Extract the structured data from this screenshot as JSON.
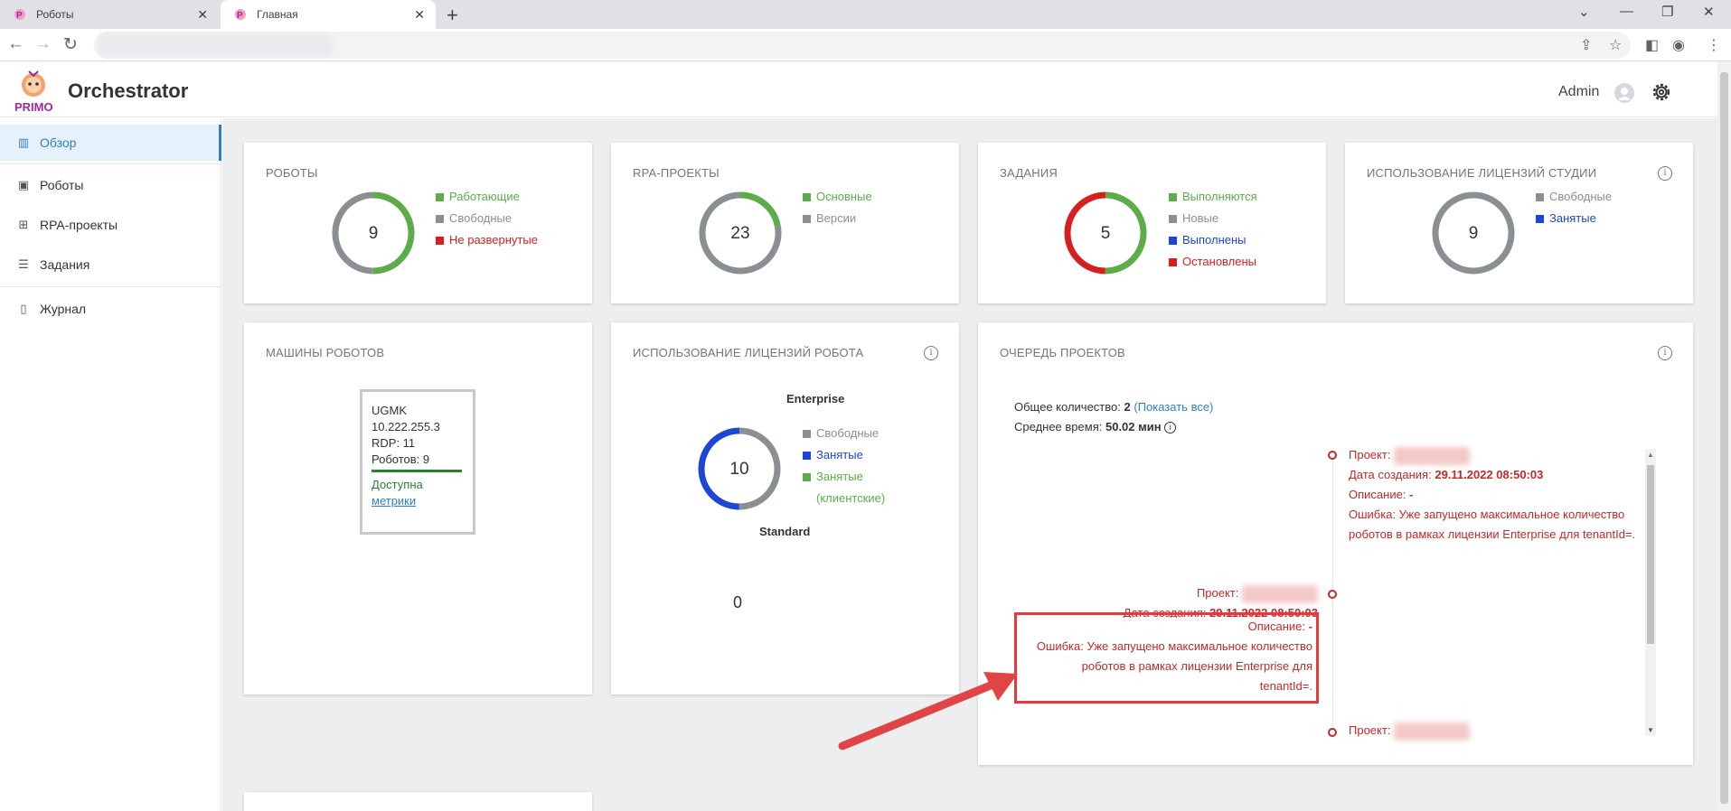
{
  "browser": {
    "tabs": [
      {
        "label": "Роботы",
        "active": false
      },
      {
        "label": "Главная",
        "active": true
      }
    ],
    "new_tab": "+",
    "controls": {
      "minimize": "—",
      "maximize": "❐",
      "close": "✕",
      "dropdown": "⌄"
    },
    "nav": {
      "back": "←",
      "forward": "→",
      "reload": "↻"
    }
  },
  "app": {
    "title": "Orchestrator",
    "logo_text": "PRIMO",
    "user": "Admin",
    "colors": {
      "accent": "#2f7fc1",
      "green": "#5cad4a",
      "grey": "#8a8f94",
      "red": "#d62020",
      "blue": "#1c47d6",
      "logo": "#9c2aa3"
    }
  },
  "sidebar": {
    "items": [
      {
        "label": "Обзор",
        "icon": "bar-chart-icon",
        "glyph": "▥",
        "active": true
      },
      {
        "label": "Роботы",
        "icon": "robot-icon",
        "glyph": "▣"
      },
      {
        "label": "RPA-проекты",
        "icon": "hierarchy-icon",
        "glyph": "⊞"
      },
      {
        "label": "Задания",
        "icon": "list-icon",
        "glyph": "☰"
      },
      {
        "label": "Журнал",
        "icon": "journal-icon",
        "glyph": "▯"
      }
    ]
  },
  "cards": {
    "robots": {
      "title": "РОБОТЫ",
      "total": "9",
      "legend": [
        {
          "label": "Работающие",
          "color": "green"
        },
        {
          "label": "Свободные",
          "color": "grey"
        },
        {
          "label": "Не развернутые",
          "color": "red"
        }
      ],
      "donut": [
        {
          "color": "#5cad4a",
          "fraction": 0.5
        },
        {
          "color": "#8a8f94",
          "fraction": 0.5
        }
      ]
    },
    "projects": {
      "title": "RPA-ПРОЕКТЫ",
      "total": "23",
      "legend": [
        {
          "label": "Основные",
          "color": "green"
        },
        {
          "label": "Версии",
          "color": "grey"
        }
      ],
      "donut": [
        {
          "color": "#5cad4a",
          "fraction": 0.22
        },
        {
          "color": "#8a8f94",
          "fraction": 0.78
        }
      ]
    },
    "jobs": {
      "title": "ЗАДАНИЯ",
      "total": "5",
      "legend": [
        {
          "label": "Выполняются",
          "color": "green"
        },
        {
          "label": "Новые",
          "color": "grey"
        },
        {
          "label": "Выполнены",
          "color": "blue"
        },
        {
          "label": "Остановлены",
          "color": "red"
        }
      ],
      "donut": [
        {
          "color": "#5cad4a",
          "fraction": 0.5
        },
        {
          "color": "#d62020",
          "fraction": 0.5
        }
      ]
    },
    "studio_licenses": {
      "title": "ИСПОЛЬЗОВАНИЕ ЛИЦЕНЗИЙ СТУДИИ",
      "total": "9",
      "legend": [
        {
          "label": "Свободные",
          "color": "grey"
        },
        {
          "label": "Занятые",
          "color": "blue"
        }
      ],
      "donut": [
        {
          "color": "#8a8f94",
          "fraction": 1.0
        }
      ]
    },
    "machines": {
      "title": "МАШИНЫ РОБОТОВ",
      "machine": {
        "name": "UGMK",
        "ip": "10.222.255.3",
        "rdp": "RDP: 11",
        "robots": "Роботов: 9",
        "status": "Доступна",
        "metrics": "метрики"
      }
    },
    "robot_licenses": {
      "title": "ИСПОЛЬЗОВАНИЕ ЛИЦЕНЗИЙ РОБОТА",
      "enterprise_label": "Enterprise",
      "enterprise_total": "10",
      "legend": [
        {
          "label": "Свободные",
          "color": "grey"
        },
        {
          "label": "Занятые",
          "color": "blue"
        },
        {
          "label": "Занятые (клиентские)",
          "color": "green"
        }
      ],
      "donut": [
        {
          "color": "#8a8f94",
          "fraction": 0.5
        },
        {
          "color": "#1c47d6",
          "fraction": 0.5
        }
      ],
      "standard_label": "Standard",
      "standard_total": "0"
    },
    "queue": {
      "title": "ОЧЕРЕДЬ ПРОЕКТОВ",
      "total_label": "Общее количество:",
      "total_value": "2",
      "show_all": "(Показать все)",
      "avg_label": "Среднее время:",
      "avg_value": "50.02 мин",
      "entries": [
        {
          "project_label": "Проект:",
          "date_label": "Дата создания:",
          "date_value": "29.11.2022 08:50:03",
          "desc_label": "Описание:",
          "desc_value": "-",
          "error": "Ошибка: Уже запущено максимальное количество роботов в рамках лицензии Enterprise для tenantId=."
        },
        {
          "project_label": "Проект:",
          "date_label": "Дата создания:",
          "date_value": "29.11.2022 08:50:03",
          "desc_label": "Описание:",
          "desc_value": "-",
          "error_line1": "Ошибка: Уже запущено максимальное количество",
          "error_line2": "роботов в рамках лицензии Enterprise для",
          "error_line3": "tenantId=."
        },
        {
          "project_label": "Проект:"
        }
      ]
    }
  }
}
